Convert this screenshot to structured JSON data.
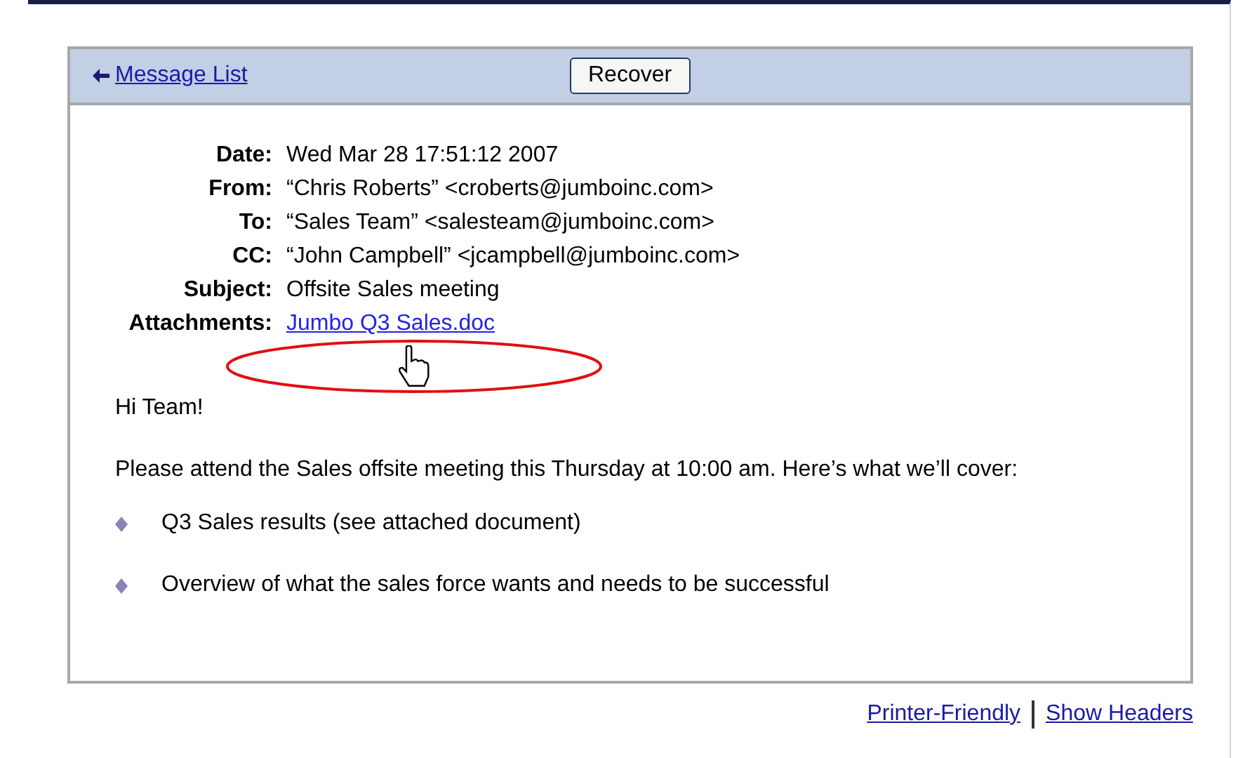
{
  "toolbar": {
    "back_link": "Message List",
    "recover_button": "Recover"
  },
  "headers": [
    {
      "label": "Date:",
      "value": "Wed Mar 28 17:51:12 2007",
      "kind": "text"
    },
    {
      "label": "From:",
      "value": "“Chris Roberts” <croberts@jumboinc.com>",
      "kind": "text"
    },
    {
      "label": "To:",
      "value": "“Sales Team” <salesteam@jumboinc.com>",
      "kind": "text"
    },
    {
      "label": "CC:",
      "value": "“John Campbell” <jcampbell@jumboinc.com>",
      "kind": "text"
    },
    {
      "label": "Subject:",
      "value": "Offsite Sales meeting",
      "kind": "text"
    },
    {
      "label": "Attachments:",
      "value": "Jumbo Q3 Sales.doc",
      "kind": "link"
    }
  ],
  "body": {
    "greeting": "Hi Team!",
    "paragraph": "Please attend the Sales offsite meeting this Thursday at 10:00 am. Here’s what we’ll cover:",
    "bullets": [
      "Q3 Sales results (see attached document)",
      "Overview of what the sales force wants and needs to be successful"
    ]
  },
  "footer_links": [
    "Printer-Friendly",
    "Show Headers"
  ]
}
